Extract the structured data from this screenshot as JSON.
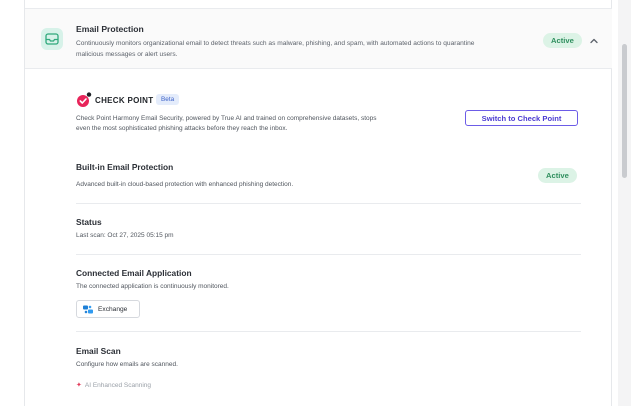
{
  "header": {
    "title": "Email Protection",
    "description": "Continuously monitors organizational email to detect threats such as malware, phishing, and spam, with automated actions to quarantine malicious messages or alert users.",
    "status": "Active",
    "icon": "mail-tray-icon",
    "toggle_icon": "chevron-up-icon"
  },
  "checkpoint": {
    "brand": "CHECK POINT",
    "badge": "Beta",
    "description": "Check Point Harmony Email Security, powered by True AI and trained on comprehensive datasets, stops even the most sophisticated phishing attacks before they reach the inbox.",
    "switch_label": "Switch to Check Point",
    "logo_colors": [
      "#e8245a",
      "#1f2328"
    ]
  },
  "builtin": {
    "title": "Built-in Email Protection",
    "description": "Advanced built-in cloud-based protection with enhanced phishing detection.",
    "status": "Active"
  },
  "status": {
    "title": "Status",
    "last_scan": "Last scan: Oct 27, 2025 05:15 pm"
  },
  "connected": {
    "title": "Connected Email Application",
    "description": "The connected application is continuously monitored.",
    "app_label": "Exchange",
    "app_icon": "exchange-icon"
  },
  "scan": {
    "title": "Email Scan",
    "description": "Configure how emails are scanned.",
    "partial_label": "AI Enhanced Scanning"
  },
  "colors": {
    "accent": "#6c5ce7",
    "active_bg": "#dcf3e6",
    "active_text": "#2f8f5e"
  }
}
